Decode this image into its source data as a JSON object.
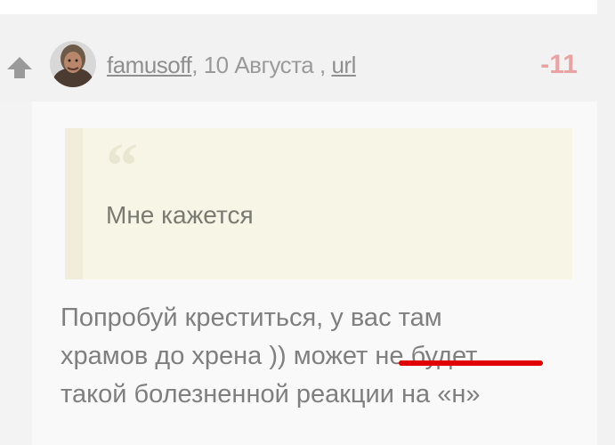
{
  "comment": {
    "author": "famusoff",
    "date_text": ", 10 Августа ,",
    "link_label": "url",
    "score": "-11",
    "quote": {
      "mark": "“",
      "text": "Мне кажется"
    },
    "body_lines": [
      " Попробуй креститься, у вас там",
      "храмов до хрена )) может не будет",
      "такой болезненной реакции на «н»"
    ],
    "colors": {
      "score": "#e9a3a3",
      "highlight_underline": "#e00000",
      "quote_bg": "#f7f5e6"
    },
    "icons": {
      "vote_up": "arrow-up-icon",
      "avatar": "user-avatar"
    }
  }
}
